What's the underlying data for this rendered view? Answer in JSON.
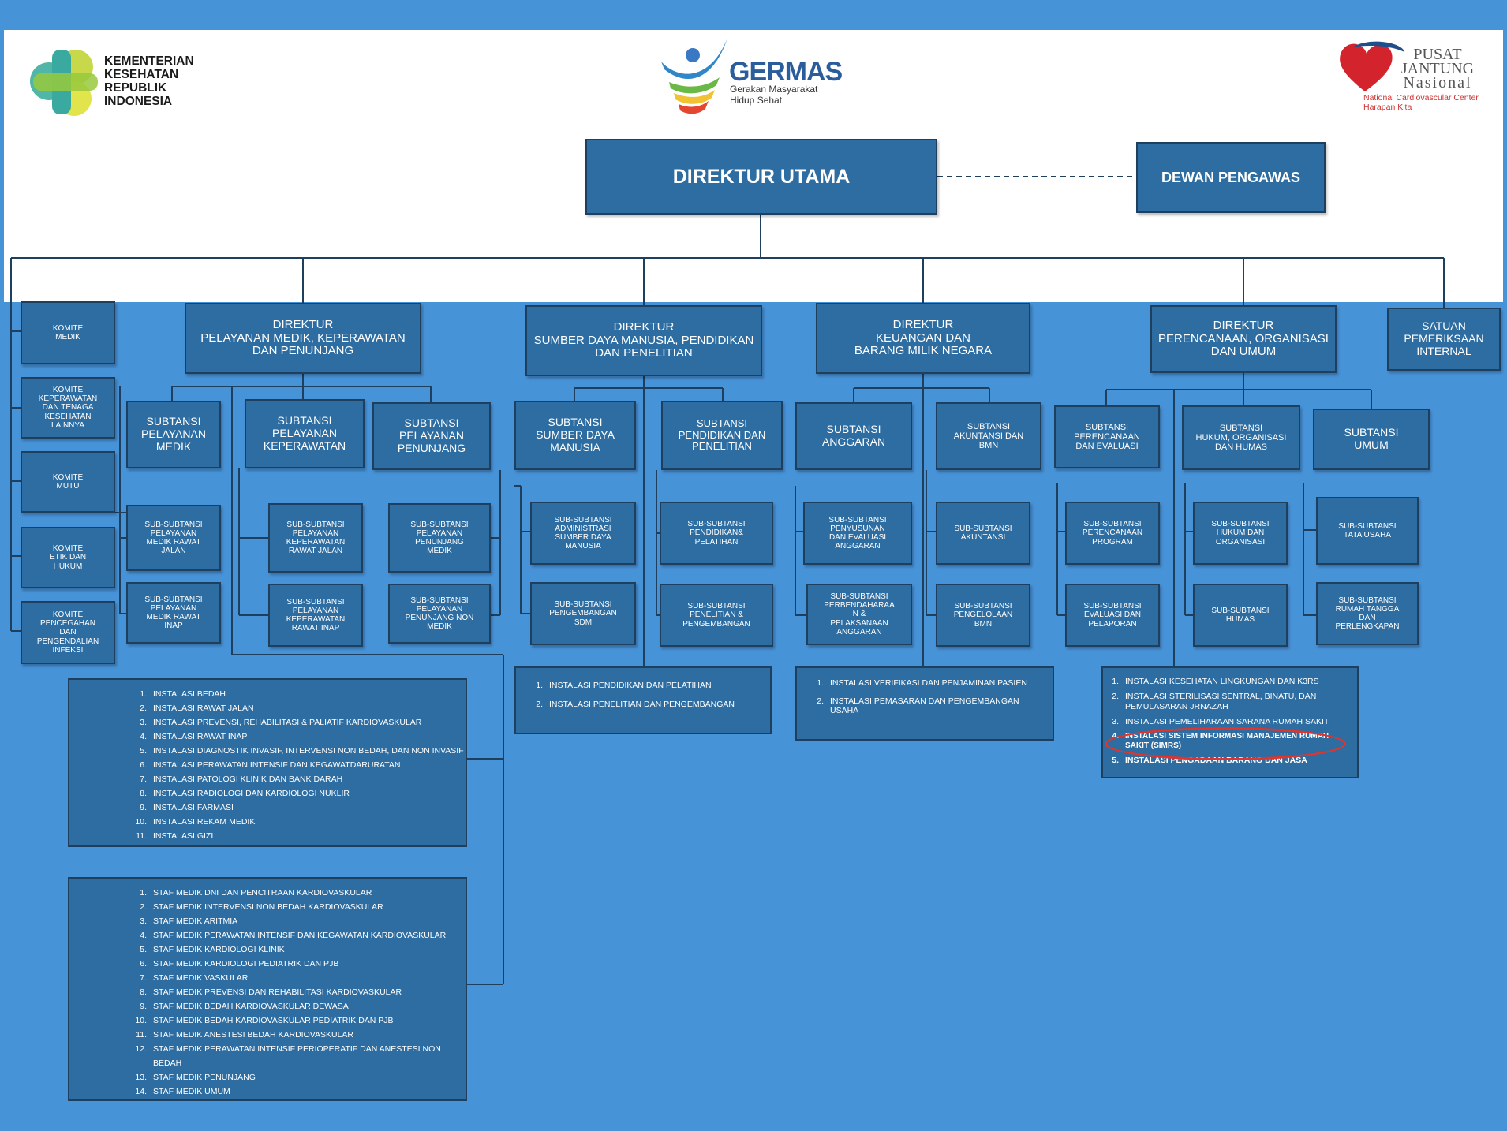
{
  "logos": {
    "kemenkes": {
      "lines": [
        "KEMENTERIAN",
        "KESEHATAN",
        "REPUBLIK",
        "INDONESIA"
      ]
    },
    "germas": {
      "title": "GERMAS",
      "sub1": "Gerakan Masyarakat",
      "sub2": "Hidup Sehat"
    },
    "pjn": {
      "line1": "PUSAT",
      "line2": "JANTUNG",
      "line3": "Nasional",
      "sub1": "National Cardiovascular Center",
      "sub2": "Harapan Kita"
    }
  },
  "colors": {
    "accent": "#4793d8",
    "box": "#2e6da1",
    "highlight": "#e0342c"
  },
  "top": {
    "direktur_utama": "DIREKTUR UTAMA",
    "dewan_pengawas": "DEWAN PENGAWAS"
  },
  "komite": [
    "KOMITE\nMEDIK",
    "KOMITE\nKEPERAWATAN\nDAN TENAGA\nKESEHATAN\nLAINNYA",
    "KOMITE\nMUTU",
    "KOMITE\nETIK DAN\nHUKUM",
    "KOMITE\nPENCEGAHAN\nDAN\nPENGENDALIAN\nINFEKSI"
  ],
  "direktur": {
    "pelayanan": "DIREKTUR\nPELAYANAN MEDIK, KEPERAWATAN\nDAN PENUNJANG",
    "sdm": "DIREKTUR\nSUMBER DAYA MANUSIA, PENDIDIKAN\nDAN PENELITIAN",
    "keuangan": "DIREKTUR\nKEUANGAN DAN\nBARANG MILIK NEGARA",
    "perencanaan": "DIREKTUR\nPERENCANAAN, ORGANISASI\nDAN UMUM",
    "spi": "SATUAN\nPEMERIKSAAN\nINTERNAL"
  },
  "subtansi": {
    "pel_medik": "SUBTANSI\nPELAYANAN\nMEDIK",
    "pel_kep": "SUBTANSI\nPELAYANAN\nKEPERAWATAN",
    "pel_penunjang": "SUBTANSI\nPELAYANAN\nPENUNJANG",
    "sdm": "SUBTANSI\nSUMBER DAYA\nMANUSIA",
    "pendidikan": "SUBTANSI\nPENDIDIKAN DAN\nPENELITIAN",
    "anggaran": "SUBTANSI\nANGGARAN",
    "akuntansi": "SUBTANSI\nAKUNTANSI DAN\nBMN",
    "perencanaan": "SUBTANSI\nPERENCANAAN\nDAN EVALUASI",
    "hukum": "SUBTANSI\nHUKUM, ORGANISASI\nDAN HUMAS",
    "umum": "SUBTANSI\nUMUM"
  },
  "sub_subtansi": {
    "medik_rj": "SUB-SUBTANSI\nPELAYANAN\nMEDIK RAWAT\nJALAN",
    "medik_ri": "SUB-SUBTANSI\nPELAYANAN\nMEDIK RAWAT\nINAP",
    "kep_rj": "SUB-SUBTANSI\nPELAYANAN\nKEPERAWATAN\nRAWAT JALAN",
    "kep_ri": "SUB-SUBTANSI\nPELAYANAN\nKEPERAWATAN\nRAWAT INAP",
    "penunjang_medik": "SUB-SUBTANSI\nPELAYANAN\nPENUNJANG\nMEDIK",
    "penunjang_non": "SUB-SUBTANSI\nPELAYANAN\nPENUNJANG NON\nMEDIK",
    "admin_sdm": "SUB-SUBTANSI\nADMINISTRASI\nSUMBER DAYA\nMANUSIA",
    "pengembangan_sdm": "SUB-SUBTANSI\nPENGEMBANGAN\nSDM",
    "pendidikan": "SUB-SUBTANSI\nPENDIDIKAN&\nPELATIHAN",
    "penelitian": "SUB-SUBTANSI\nPENELITIAN &\nPENGEMBANGAN",
    "penyusunan": "SUB-SUBTANSI\nPENYUSUNAN\nDAN EVALUASI\nANGGARAN",
    "perbendaharaan": "SUB-SUBTANSI\nPERBENDAHARAA\nN &\nPELAKSANAAN\nANGGARAN",
    "akuntansi": "SUB-SUBTANSI\nAKUNTANSI",
    "bmn": "SUB-SUBTANSI\nPENGELOLAAN\nBMN",
    "program": "SUB-SUBTANSI\nPERENCANAAN\nPROGRAM",
    "evaluasi": "SUB-SUBTANSI\nEVALUASI DAN\nPELAPORAN",
    "hukum": "SUB-SUBTANSI\nHUKUM DAN\nORGANISASI",
    "humas": "SUB-SUBTANSI\nHUMAS",
    "tata_usaha": "SUB-SUBTANSI\nTATA USAHA",
    "rumah_tangga": "SUB-SUBTANSI\nRUMAH TANGGA\nDAN\nPERLENGKAPAN"
  },
  "instalasi_pelayanan": [
    {
      "n": "1.",
      "t": "INSTALASI BEDAH"
    },
    {
      "n": "2.",
      "t": "INSTALASI RAWAT JALAN"
    },
    {
      "n": "3.",
      "t": "INSTALASI PREVENSI, REHABILITASI & PALIATIF KARDIOVASKULAR"
    },
    {
      "n": "4.",
      "t": "INSTALASI RAWAT INAP"
    },
    {
      "n": "5.",
      "t": "INSTALASI DIAGNOSTIK INVASIF, INTERVENSI NON BEDAH, DAN NON INVASIF"
    },
    {
      "n": "6.",
      "t": "INSTALASI PERAWATAN INTENSIF DAN KEGAWATDARURATAN"
    },
    {
      "n": "7.",
      "t": "INSTALASI PATOLOGI KLINIK DAN BANK DARAH"
    },
    {
      "n": "8.",
      "t": "INSTALASI RADIOLOGI DAN KARDIOLOGI NUKLIR"
    },
    {
      "n": "9.",
      "t": "INSTALASI FARMASI"
    },
    {
      "n": "10.",
      "t": "INSTALASI REKAM MEDIK"
    },
    {
      "n": "11.",
      "t": "INSTALASI GIZI"
    }
  ],
  "staf_medik": [
    {
      "n": "1.",
      "t": "STAF MEDIK DNI DAN PENCITRAAN KARDIOVASKULAR"
    },
    {
      "n": "2.",
      "t": "STAF MEDIK INTERVENSI NON BEDAH KARDIOVASKULAR"
    },
    {
      "n": "3.",
      "t": "STAF MEDIK ARITMIA"
    },
    {
      "n": "4.",
      "t": "STAF MEDIK PERAWATAN INTENSIF DAN KEGAWATAN KARDIOVASKULAR"
    },
    {
      "n": "5.",
      "t": "STAF MEDIK KARDIOLOGI KLINIK"
    },
    {
      "n": "6.",
      "t": "STAF MEDIK KARDIOLOGI PEDIATRIK DAN PJB"
    },
    {
      "n": "7.",
      "t": "STAF MEDIK VASKULAR"
    },
    {
      "n": "8.",
      "t": "STAF MEDIK PREVENSI DAN REHABILITASI KARDIOVASKULAR"
    },
    {
      "n": "9.",
      "t": "STAF MEDIK BEDAH KARDIOVASKULAR DEWASA"
    },
    {
      "n": "10.",
      "t": "STAF MEDIK BEDAH KARDIOVASKULAR PEDIATRIK DAN PJB"
    },
    {
      "n": "11.",
      "t": "STAF MEDIK ANESTESI BEDAH KARDIOVASKULAR"
    },
    {
      "n": "12.",
      "t": "STAF MEDIK PERAWATAN INTENSIF PERIOPERATIF DAN ANESTESI NON BEDAH"
    },
    {
      "n": "13.",
      "t": "STAF MEDIK PENUNJANG"
    },
    {
      "n": "14.",
      "t": "STAF MEDIK UMUM"
    }
  ],
  "instalasi_sdm": [
    {
      "n": "1.",
      "t": "INSTALASI PENDIDIKAN DAN PELATIHAN"
    },
    {
      "n": "2.",
      "t": "INSTALASI PENELITIAN DAN PENGEMBANGAN"
    }
  ],
  "instalasi_keuangan": [
    {
      "n": "1.",
      "t": "INSTALASI VERIFIKASI DAN PENJAMINAN PASIEN"
    },
    {
      "n": "2.",
      "t": "INSTALASI PEMASARAN DAN PENGEMBANGAN USAHA"
    }
  ],
  "instalasi_umum": [
    {
      "n": "1.",
      "t": "INSTALASI KESEHATAN LINGKUNGAN DAN K3RS"
    },
    {
      "n": "2.",
      "t": "INSTALASI STERILISASI SENTRAL, BINATU, DAN PEMULASARAN JRNAZAH"
    },
    {
      "n": "3.",
      "t": "INSTALASI PEMELIHARAAN SARANA RUMAH SAKIT"
    },
    {
      "n": "4.",
      "t": "INSTALASI SISTEM INFORMASI MANAJEMEN RUMAH SAKIT (SIMRS)"
    },
    {
      "n": "5.",
      "t": "INSTALASI PENGADAAN BARANG DAN JASA"
    }
  ]
}
